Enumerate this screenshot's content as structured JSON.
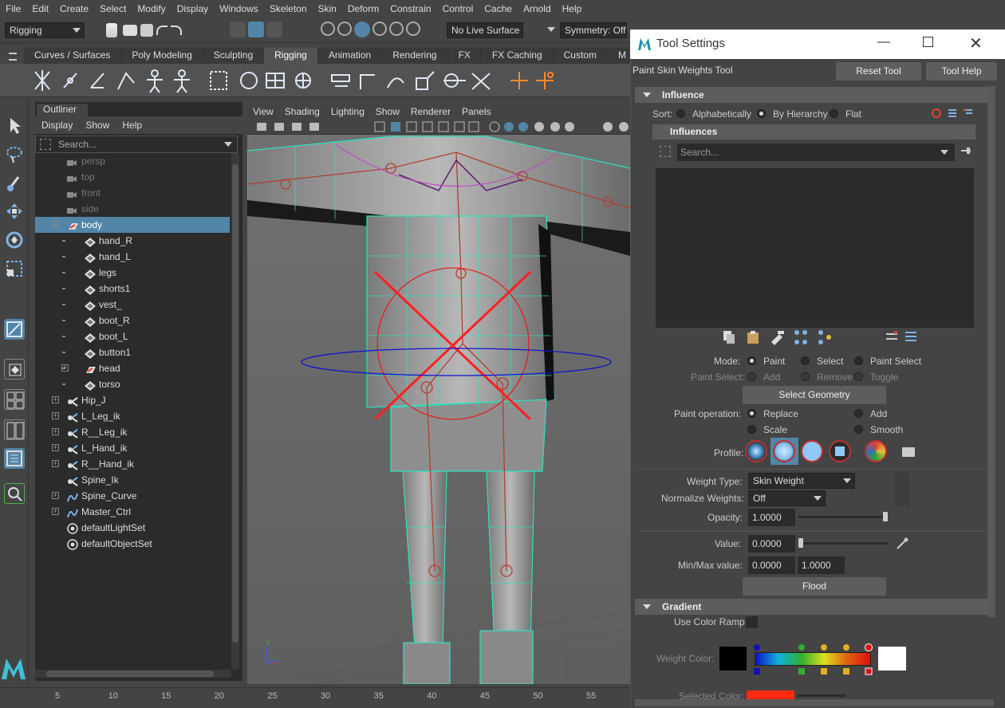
{
  "menubar": [
    "File",
    "Edit",
    "Create",
    "Select",
    "Modify",
    "Display",
    "Windows",
    "Skeleton",
    "Skin",
    "Deform",
    "Constrain",
    "Control",
    "Cache",
    "Arnold",
    "Help"
  ],
  "status": {
    "mode": "Rigging",
    "live_surface": "No Live Surface",
    "symmetry": "Symmetry: Off"
  },
  "shelf_tabs": [
    "Curves / Surfaces",
    "Poly Modeling",
    "Sculpting",
    "Rigging",
    "Animation",
    "Rendering",
    "FX",
    "FX Caching",
    "Custom",
    "M"
  ],
  "shelf_active": "Rigging",
  "outliner": {
    "title": "Outliner",
    "menu": [
      "Display",
      "Show",
      "Help"
    ],
    "search_placeholder": "Search...",
    "rows": [
      {
        "label": "persp",
        "indent": 1,
        "icon": "camera",
        "dim": true
      },
      {
        "label": "top",
        "indent": 1,
        "icon": "camera",
        "dim": true
      },
      {
        "label": "front",
        "indent": 1,
        "icon": "camera",
        "dim": true
      },
      {
        "label": "side",
        "indent": 1,
        "icon": "camera",
        "dim": true
      },
      {
        "label": "body",
        "indent": 1,
        "icon": "mesh-group",
        "selected": true,
        "expander": "minus"
      },
      {
        "label": "hand_R",
        "indent": 2,
        "icon": "mesh"
      },
      {
        "label": "hand_L",
        "indent": 2,
        "icon": "mesh"
      },
      {
        "label": "legs",
        "indent": 2,
        "icon": "mesh"
      },
      {
        "label": "shorts1",
        "indent": 2,
        "icon": "mesh"
      },
      {
        "label": "vest_",
        "indent": 2,
        "icon": "mesh"
      },
      {
        "label": "boot_R",
        "indent": 2,
        "icon": "mesh"
      },
      {
        "label": "boot_L",
        "indent": 2,
        "icon": "mesh"
      },
      {
        "label": "button1",
        "indent": 2,
        "icon": "mesh"
      },
      {
        "label": "head",
        "indent": 2,
        "icon": "mesh-group",
        "expander": "plus"
      },
      {
        "label": "torso",
        "indent": 2,
        "icon": "mesh"
      },
      {
        "label": "Hip_J",
        "indent": 1,
        "icon": "joint",
        "expander": "plus"
      },
      {
        "label": "L_Leg_ik",
        "indent": 1,
        "icon": "ik",
        "expander": "plus"
      },
      {
        "label": "R__Leg_ik",
        "indent": 1,
        "icon": "ik",
        "expander": "plus"
      },
      {
        "label": "L_Hand_ik",
        "indent": 1,
        "icon": "ik",
        "expander": "plus"
      },
      {
        "label": "R__Hand_ik",
        "indent": 1,
        "icon": "ik",
        "expander": "plus"
      },
      {
        "label": "Spine_Ik",
        "indent": 1,
        "icon": "ik"
      },
      {
        "label": "Spine_Curve",
        "indent": 1,
        "icon": "curve",
        "expander": "plus"
      },
      {
        "label": "Master_Ctrl",
        "indent": 1,
        "icon": "curve",
        "expander": "plus"
      },
      {
        "label": "defaultLightSet",
        "indent": 1,
        "icon": "set"
      },
      {
        "label": "defaultObjectSet",
        "indent": 1,
        "icon": "set"
      }
    ]
  },
  "viewport": {
    "menu": [
      "View",
      "Shading",
      "Lighting",
      "Show",
      "Renderer",
      "Panels"
    ]
  },
  "timeline": [
    "5",
    "10",
    "15",
    "20",
    "25",
    "30",
    "35",
    "40",
    "45",
    "50",
    "55"
  ],
  "tool_settings": {
    "title": "Tool Settings",
    "tool_name": "Paint Skin Weights Tool",
    "reset_label": "Reset Tool",
    "help_label": "Tool Help",
    "influence_section": "Influence",
    "sort_label": "Sort:",
    "sort_options": [
      "Alphabetically",
      "By Hierarchy",
      "Flat"
    ],
    "sort_selected": "By Hierarchy",
    "influences_header": "Influences",
    "search_placeholder": "Search...",
    "mode_label": "Mode:",
    "mode_options": [
      "Paint",
      "Select",
      "Paint Select"
    ],
    "mode_selected": "Paint",
    "paint_select_label": "Paint Select:",
    "paint_select_options": [
      "Add",
      "Remove",
      "Toggle"
    ],
    "select_geometry_label": "Select Geometry",
    "paint_operation_label": "Paint operation:",
    "paint_operations": [
      "Replace",
      "Add",
      "Scale",
      "Smooth"
    ],
    "paint_operation_selected": "Replace",
    "profile_label": "Profile:",
    "weight_type_label": "Weight Type:",
    "weight_type_value": "Skin Weight",
    "normalize_label": "Normalize Weights:",
    "normalize_value": "Off",
    "opacity_label": "Opacity:",
    "opacity_value": "1.0000",
    "opacity_fraction": 1.0,
    "value_label": "Value:",
    "value_value": "0.0000",
    "value_fraction": 0.0,
    "minmax_label": "Min/Max value:",
    "min_value": "0.0000",
    "max_value": "1.0000",
    "flood_label": "Flood",
    "gradient_section": "Gradient",
    "use_color_ramp_label": "Use Color Ramp",
    "weight_color_label": "Weight Color:",
    "selected_color_label": "Selected Color:",
    "selected_color": "#ff2a10"
  }
}
